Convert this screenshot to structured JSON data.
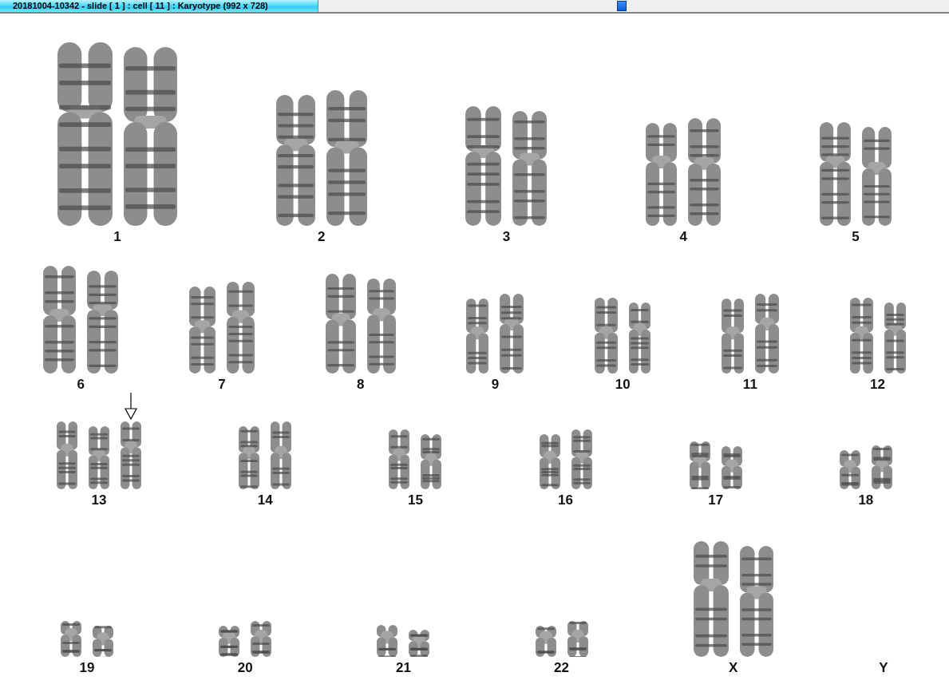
{
  "window": {
    "title": "20181004-10342 - slide [ 1 ] : cell [ 11 ] : Karyotype  (992 x 728)"
  },
  "rows": [
    {
      "groups": [
        {
          "label": "1",
          "chromosomes": [
            {
              "marked": false
            },
            {
              "marked": false
            }
          ]
        },
        {
          "label": "2",
          "chromosomes": [
            {
              "marked": false
            },
            {
              "marked": false
            }
          ]
        },
        {
          "label": "3",
          "chromosomes": [
            {
              "marked": false
            },
            {
              "marked": false
            }
          ]
        },
        {
          "label": "4",
          "chromosomes": [
            {
              "marked": false
            },
            {
              "marked": false
            }
          ]
        },
        {
          "label": "5",
          "chromosomes": [
            {
              "marked": false
            },
            {
              "marked": false
            }
          ]
        }
      ]
    },
    {
      "groups": [
        {
          "label": "6",
          "chromosomes": [
            {
              "marked": false
            },
            {
              "marked": false
            }
          ]
        },
        {
          "label": "7",
          "chromosomes": [
            {
              "marked": false
            },
            {
              "marked": false
            }
          ]
        },
        {
          "label": "8",
          "chromosomes": [
            {
              "marked": false
            },
            {
              "marked": false
            }
          ]
        },
        {
          "label": "9",
          "chromosomes": [
            {
              "marked": false
            },
            {
              "marked": false
            }
          ]
        },
        {
          "label": "10",
          "chromosomes": [
            {
              "marked": false
            },
            {
              "marked": false
            }
          ]
        },
        {
          "label": "11",
          "chromosomes": [
            {
              "marked": false
            },
            {
              "marked": false
            }
          ]
        },
        {
          "label": "12",
          "chromosomes": [
            {
              "marked": false
            },
            {
              "marked": false
            }
          ]
        }
      ]
    },
    {
      "groups": [
        {
          "label": "13",
          "chromosomes": [
            {
              "marked": false
            },
            {
              "marked": false
            },
            {
              "marked": true
            }
          ]
        },
        {
          "label": "14",
          "chromosomes": [
            {
              "marked": false
            },
            {
              "marked": false
            }
          ]
        },
        {
          "label": "15",
          "chromosomes": [
            {
              "marked": false
            },
            {
              "marked": false
            }
          ]
        },
        {
          "label": "16",
          "chromosomes": [
            {
              "marked": false
            },
            {
              "marked": false
            }
          ]
        },
        {
          "label": "17",
          "chromosomes": [
            {
              "marked": false
            },
            {
              "marked": false
            }
          ]
        },
        {
          "label": "18",
          "chromosomes": [
            {
              "marked": false
            },
            {
              "marked": false
            }
          ]
        }
      ]
    },
    {
      "groups": [
        {
          "label": "19",
          "chromosomes": [
            {
              "marked": false
            },
            {
              "marked": false
            }
          ]
        },
        {
          "label": "20",
          "chromosomes": [
            {
              "marked": false
            },
            {
              "marked": false
            }
          ]
        },
        {
          "label": "21",
          "chromosomes": [
            {
              "marked": false
            },
            {
              "marked": false
            }
          ]
        },
        {
          "label": "22",
          "chromosomes": [
            {
              "marked": false
            },
            {
              "marked": false
            }
          ]
        },
        {
          "label": "X",
          "chromosomes": [
            {
              "marked": false
            },
            {
              "marked": false
            }
          ]
        },
        {
          "label": "Y"
        }
      ]
    }
  ]
}
